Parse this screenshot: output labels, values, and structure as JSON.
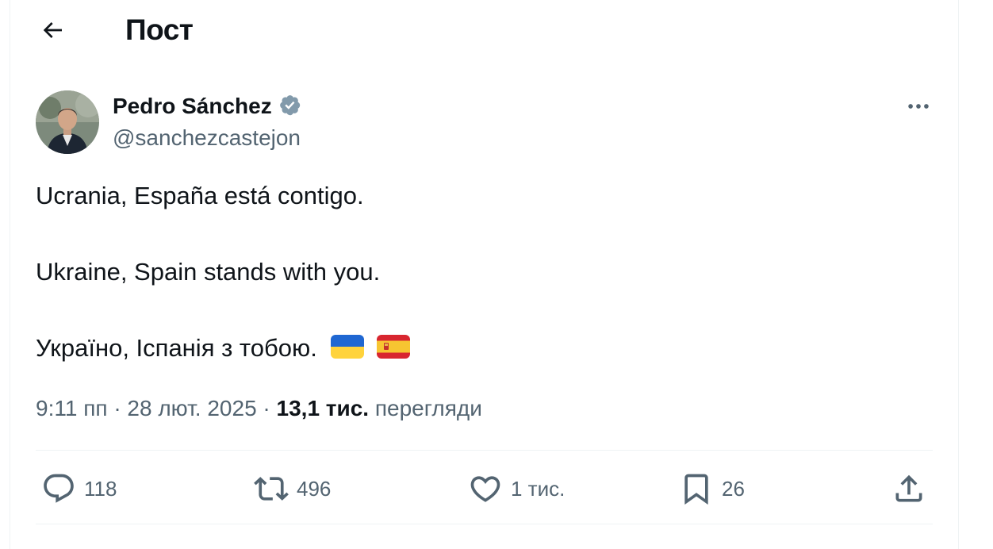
{
  "header": {
    "title": "Пост"
  },
  "post": {
    "author": {
      "name": "Pedro Sánchez",
      "handle": "@sanchezcastejon",
      "verified": true
    },
    "text_lines": [
      "Ucrania, España está contigo.",
      "Ukraine, Spain stands with you.",
      "Україно, Іспанія з тобою."
    ],
    "flags": [
      "ukraine-flag",
      "spain-flag"
    ],
    "meta": {
      "time": "9:11 пп",
      "separator": "·",
      "date": "28 лют. 2025",
      "views_count": "13,1 тис.",
      "views_label": "перегляди"
    },
    "actions": {
      "replies": "118",
      "reposts": "496",
      "likes": "1 тис.",
      "bookmarks": "26"
    }
  },
  "colors": {
    "text": "#0f1419",
    "secondary": "#536471",
    "divider": "#eff3f4",
    "verified": "#829aab"
  }
}
